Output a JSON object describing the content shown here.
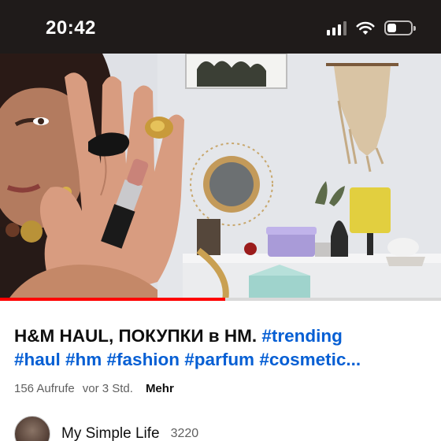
{
  "status": {
    "time": "20:42"
  },
  "video": {
    "progress_percent": 51
  },
  "title": {
    "text": "H&M HAUL, ПОКУПКИ в НМ.",
    "hashtags_line1": "#trending",
    "hashtags_line2": "#haul #hm #fashion #parfum #cosmetic..."
  },
  "meta": {
    "views": "156 Aufrufe",
    "age": "vor 3 Std.",
    "more": "Mehr"
  },
  "channel": {
    "name": "My Simple Life",
    "subscribers": "3220"
  },
  "colors": {
    "accent_link": "#065fd4",
    "progress": "#ff0000"
  }
}
